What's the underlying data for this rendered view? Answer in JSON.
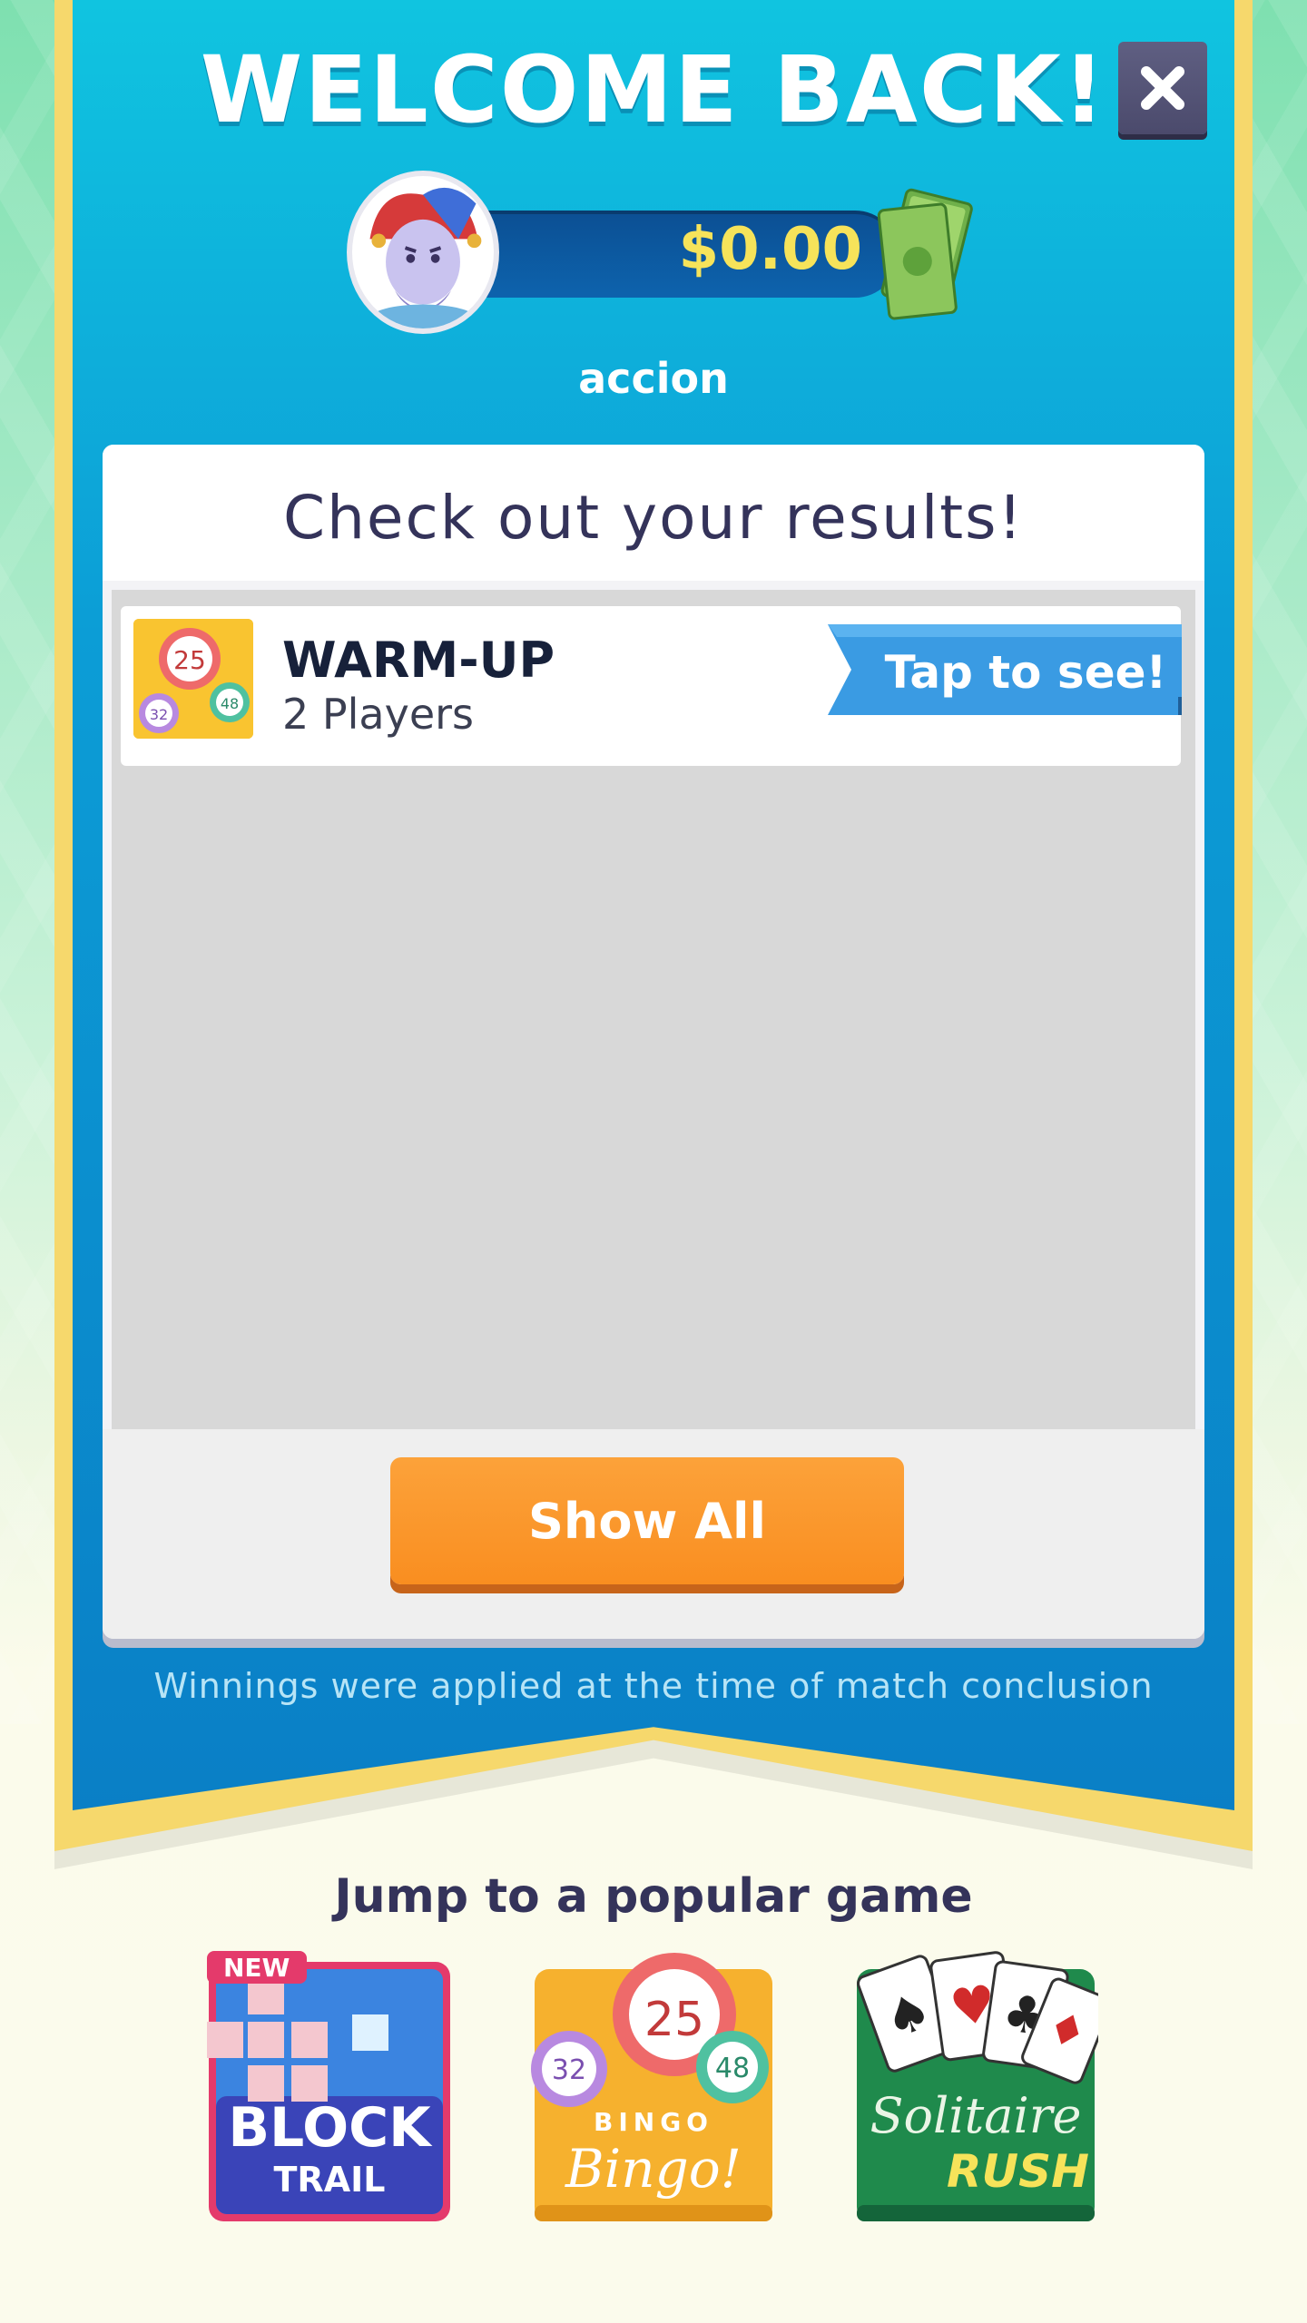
{
  "header": {
    "title": "WELCOME BACK!",
    "balance": "$0.00",
    "username": "accion",
    "close_icon": "close-icon",
    "money_icon": "cash-stack-icon",
    "avatar_icon": "jester-avatar-icon"
  },
  "results": {
    "title": "Check out your results!",
    "items": [
      {
        "name": "WARM-UP",
        "players": "2 Players",
        "action": "Tap to see!",
        "icon": "bingo-balls-icon"
      }
    ],
    "show_all_label": "Show All",
    "note": "Winnings were applied at the time of match conclusion"
  },
  "popular": {
    "title": "Jump to a popular game",
    "games": [
      {
        "name": "BLOCK",
        "sub": "TRAIL",
        "badge": "NEW"
      },
      {
        "name": "Bingo!",
        "sub": "BINGO",
        "balls": [
          "25",
          "32",
          "48"
        ],
        "letters": [
          "I",
          "N",
          "G"
        ]
      },
      {
        "name": "Solitaire",
        "sub": "RUSH"
      }
    ]
  },
  "colors": {
    "banner_blue": "#0c9dd6",
    "banner_gold": "#f6d86c",
    "accent_orange": "#f98e20",
    "balance_yellow": "#f6e35a",
    "ribbon_blue": "#3a9be3"
  }
}
